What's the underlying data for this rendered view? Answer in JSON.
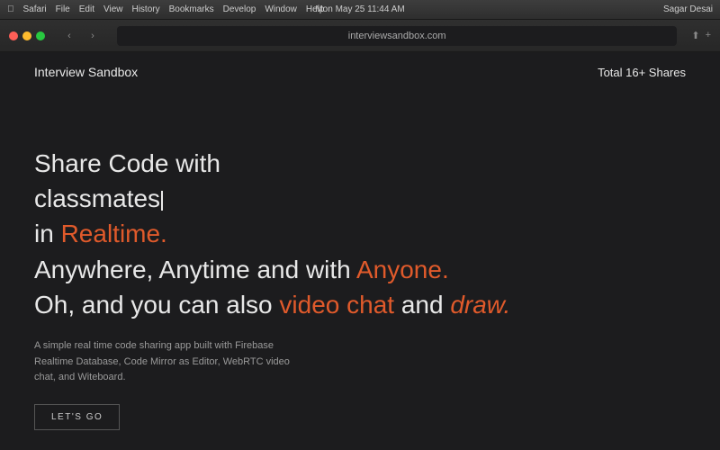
{
  "os_bar": {
    "left_items": [
      "Safari",
      "File",
      "Edit",
      "View",
      "History",
      "Bookmarks",
      "Develop",
      "Window",
      "Help"
    ],
    "center": "Mon May 25  11:44 AM",
    "right": "Sagar Desai"
  },
  "browser": {
    "url": "interviewsandbox.com",
    "back_label": "‹",
    "forward_label": "›"
  },
  "site": {
    "logo": "Interview Sandbox",
    "shares_label": "Total 16+ Shares",
    "hero": {
      "line1": "Share Code with",
      "line2": "classmates",
      "line3_pre": "in ",
      "line3_highlight": "Realtime.",
      "line4_pre": "Anywhere, Anytime and with ",
      "line4_highlight": "Anyone.",
      "line5_pre": "Oh, and you can also ",
      "line5_highlight1": "video chat",
      "line5_mid": " and ",
      "line5_highlight2": "draw.",
      "subtext": "A simple real time code sharing app built with Firebase Realtime Database, Code Mirror as Editor, WebRTC video chat, and Witeboard.",
      "cta_label": "LET'S GO"
    }
  }
}
